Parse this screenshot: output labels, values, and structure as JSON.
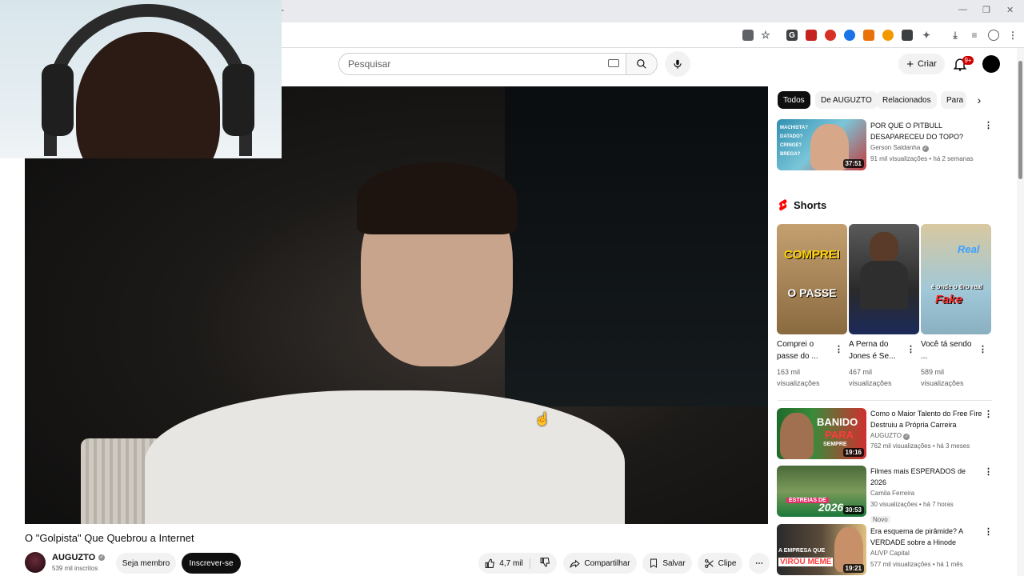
{
  "browser": {
    "new_tab_symbol": "+",
    "window_controls": [
      "—",
      "❐",
      "✕"
    ]
  },
  "header": {
    "search_placeholder": "Pesquisar",
    "create_label": "Criar",
    "notifications_badge": "9+"
  },
  "video": {
    "title": "O \"Golpista\" Que Quebrou a Internet",
    "channel_name": "AUGUZTO",
    "subscribers": "539 mil inscritos",
    "join_label": "Seja membro",
    "subscribe_label": "Inscrever-se",
    "likes": "4,7 mil",
    "share_label": "Compartilhar",
    "save_label": "Salvar",
    "clip_label": "Clipe"
  },
  "sidebar": {
    "chips": [
      "Todos",
      "De AUGUZTO",
      "Relacionados",
      "Para"
    ],
    "first_video": {
      "title": "POR QUE O PITBULL DESAPARECEU DO TOPO?",
      "channel": "Gerson Saldanha",
      "meta": "91 mil visualizações • há 2 semanas",
      "duration": "37:51",
      "thumb_text": [
        "MACHISTA?",
        "DATADO?",
        "CRINGE?",
        "BREGA?"
      ]
    },
    "shorts_heading": "Shorts",
    "shorts": [
      {
        "title": "Comprei o passe do ...",
        "views": "163 mil visualizações",
        "thumb_text": [
          "COMPREI",
          "O PASSE"
        ]
      },
      {
        "title": "A Perna do Jones é Se...",
        "views": "467 mil visualizações",
        "thumb_text": []
      },
      {
        "title": "Você tá sendo ...",
        "views": "589 mil visualizações",
        "thumb_text": [
          "Real",
          "é onde o tiro real",
          "Fake"
        ]
      }
    ],
    "videos": [
      {
        "title": "Como o Maior Talento do Free Fire Destruiu a Própria Carreira",
        "channel": "AUGUZTO",
        "meta": "762 mil visualizações • há 3 meses",
        "duration": "19:16",
        "thumb_text": [
          "BANIDO",
          "PARA",
          "SEMPRE"
        ],
        "badge": ""
      },
      {
        "title": "Filmes mais ESPERADOS de 2026",
        "channel": "Camila Ferreira",
        "meta": "30 visualizações • há 7 horas",
        "duration": "30:53",
        "thumb_text": [
          "ESTREIAS DE",
          "2026"
        ],
        "badge": "Novo"
      },
      {
        "title": "Era esquema de pirâmide? A VERDADE sobre a Hinode",
        "channel": "AUVP Capital",
        "meta": "577 mil visualizações • há 1 mês",
        "duration": "19:21",
        "thumb_text": [
          "A EMPRESA QUE",
          "VIROU MEME"
        ],
        "badge": ""
      }
    ]
  },
  "icons": {
    "search": "search-icon",
    "mic": "mic-icon",
    "bell": "bell-icon",
    "like": "thumbs-up-icon",
    "dislike": "thumbs-down-icon",
    "share": "share-icon",
    "save": "bookmark-icon",
    "clip": "scissors-icon",
    "more": "more-horizontal-icon"
  },
  "colors": {
    "brand_red": "#ff0000",
    "text_primary": "#0f0f0f",
    "text_secondary": "#606060",
    "chip_bg": "#f2f2f2"
  }
}
